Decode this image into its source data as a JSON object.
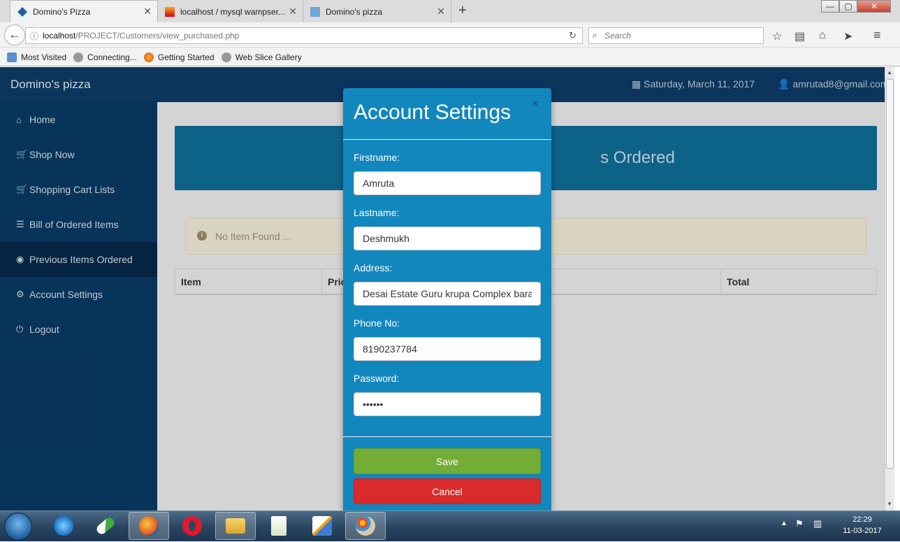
{
  "browser": {
    "tabs": [
      {
        "label": "Domino's Pizza",
        "active": true
      },
      {
        "label": "localhost / mysql wampser...",
        "active": false
      },
      {
        "label": "Domino's pizza",
        "active": false
      }
    ],
    "new_tab": "+",
    "window_controls": {
      "minimize": "—",
      "maximize": "▢",
      "close": "✕"
    },
    "url": {
      "host": "localhost",
      "path": "/PROJECT/Customers/view_purchased.php"
    },
    "search_placeholder": "Search",
    "bookmarks": [
      "Most Visited",
      "Connecting...",
      "Getting Started",
      "Web Slice Gallery"
    ]
  },
  "app": {
    "brand": "Domino's pizza",
    "date": "Saturday, March 11, 2017",
    "email": "amrutad8@gmail.com",
    "sidebar": [
      {
        "label": "Home",
        "icon": "home-icon",
        "glyph": "⌂"
      },
      {
        "label": "Shop Now",
        "icon": "cart-icon",
        "glyph": "🛒"
      },
      {
        "label": "Shopping Cart Lists",
        "icon": "cart-icon",
        "glyph": "🛒"
      },
      {
        "label": "Bill of Ordered Items",
        "icon": "list-icon",
        "glyph": "☰"
      },
      {
        "label": "Previous Items Ordered",
        "icon": "eye-icon",
        "glyph": "◉",
        "active": true
      },
      {
        "label": "Account Settings",
        "icon": "gear-icon",
        "glyph": "⚙"
      },
      {
        "label": "Logout",
        "icon": "power-icon",
        "glyph": "⏻"
      }
    ],
    "banner_visible_text": "s Ordered",
    "alert": "No Item Found ...",
    "table_headers": {
      "item": "Item",
      "price": "Pric",
      "total": "Total"
    }
  },
  "modal": {
    "title": "Account Settings",
    "close": "×",
    "fields": {
      "firstname": {
        "label": "Firstname:",
        "value": "Amruta"
      },
      "lastname": {
        "label": "Lastname:",
        "value": "Deshmukh"
      },
      "address": {
        "label": "Address:",
        "value": "Desai Estate Guru krupa Complex bara"
      },
      "phone": {
        "label": "Phone No:",
        "value": "8190237784"
      },
      "password": {
        "label": "Password:",
        "value": "••••••"
      }
    },
    "save": "Save",
    "cancel": "Cancel"
  },
  "taskbar": {
    "clock_time": "22:29",
    "clock_date": "11-03-2017",
    "apps": [
      "internet-explorer-icon",
      "pill-app-icon",
      "firefox-icon",
      "opera-icon",
      "file-explorer-icon",
      "notepad-icon",
      "pen-app-icon",
      "paint-icon"
    ]
  },
  "colors": {
    "topnav": "#0d3b66",
    "sidebar": "#0b3a64",
    "modal": "#1287bd",
    "save": "#72ad35",
    "cancel": "#d92b2b"
  }
}
